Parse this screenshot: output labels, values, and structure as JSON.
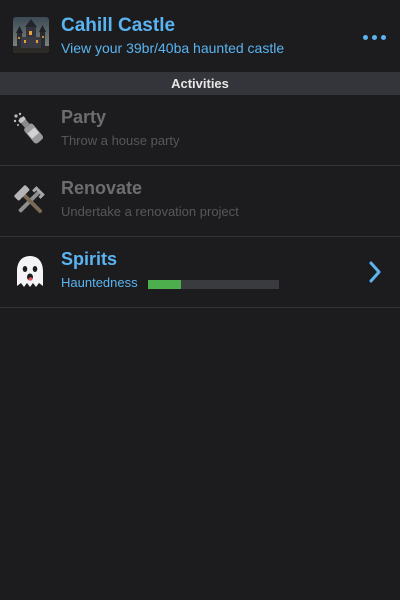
{
  "header": {
    "title": "Cahill Castle",
    "subtitle": "View your 39br/40ba haunted castle",
    "thumbnail_icon": "haunted-castle-icon",
    "more_icon": "ellipsis-icon"
  },
  "section": {
    "title": "Activities"
  },
  "activities": [
    {
      "title": "Party",
      "subtitle": "Throw a house party",
      "icon": "champagne-icon",
      "enabled": false
    },
    {
      "title": "Renovate",
      "subtitle": "Undertake a renovation project",
      "icon": "tools-icon",
      "enabled": false
    },
    {
      "title": "Spirits",
      "subtitle": "Hauntedness",
      "icon": "ghost-icon",
      "enabled": true,
      "meter_level": 0.25,
      "chevron_icon": "chevron-right-icon"
    }
  ],
  "colors": {
    "accent": "#5ab4f1",
    "background": "#1c1c1e",
    "meter_fill": "#4cae4c"
  }
}
